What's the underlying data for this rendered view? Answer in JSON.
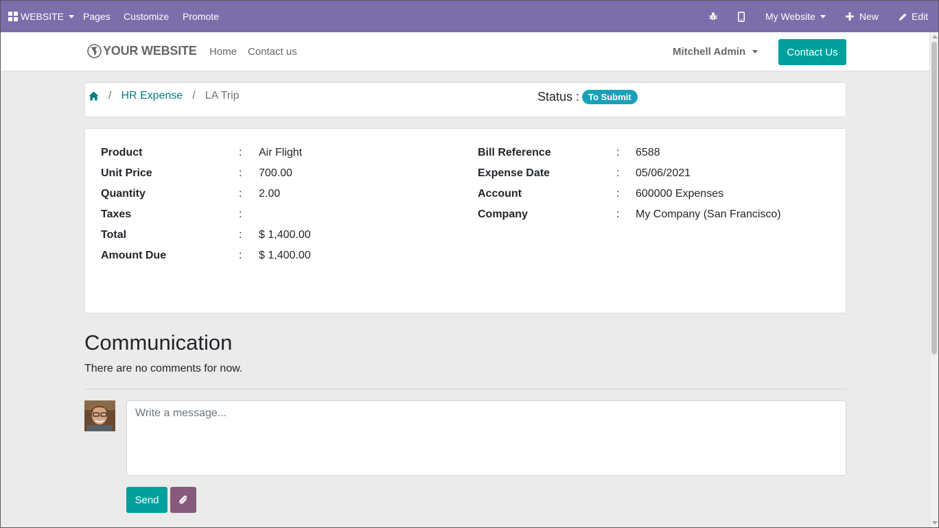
{
  "adminbar": {
    "website_label": "WEBSITE",
    "menu": [
      "Pages",
      "Customize",
      "Promote"
    ],
    "site_selector": "My Website",
    "new_label": "New",
    "edit_label": "Edit"
  },
  "header": {
    "logo_text": "YOUR WEBSITE",
    "nav": [
      "Home",
      "Contact us"
    ],
    "user": "Mitchell Admin",
    "contact_button": "Contact Us"
  },
  "breadcrumb": {
    "items": [
      "HR Expense",
      "LA Trip"
    ],
    "separator": "/",
    "status_label": "Status :",
    "status_value": "To Submit"
  },
  "details": {
    "left": [
      {
        "label": "Product",
        "value": "Air Flight"
      },
      {
        "label": "Unit Price",
        "value": "700.00"
      },
      {
        "label": "Quantity",
        "value": "2.00"
      },
      {
        "label": "Taxes",
        "value": ""
      },
      {
        "label": "Total",
        "value": "$ 1,400.00"
      },
      {
        "label": "Amount Due",
        "value": "$ 1,400.00"
      }
    ],
    "right": [
      {
        "label": "Bill Reference",
        "value": "6588"
      },
      {
        "label": "Expense Date",
        "value": "05/06/2021"
      },
      {
        "label": "Account",
        "value": "600000 Expenses"
      },
      {
        "label": "Company",
        "value": "My Company (San Francisco)"
      }
    ],
    "colon": ":"
  },
  "communication": {
    "title": "Communication",
    "empty_text": "There are no comments for now.",
    "placeholder": "Write a message...",
    "send_label": "Send"
  },
  "colors": {
    "admin_bar": "#7c6dab",
    "primary": "#00a09d",
    "secondary": "#875a7b",
    "badge": "#17a2b8",
    "link": "#017e84"
  },
  "icons": {
    "apps": "apps-grid-icon",
    "debug": "bug-icon",
    "mobile": "mobile-phone-icon",
    "new": "plus-icon",
    "edit": "pencil-icon",
    "logo": "globe-icon",
    "home": "home-icon",
    "attach": "paperclip-icon"
  }
}
